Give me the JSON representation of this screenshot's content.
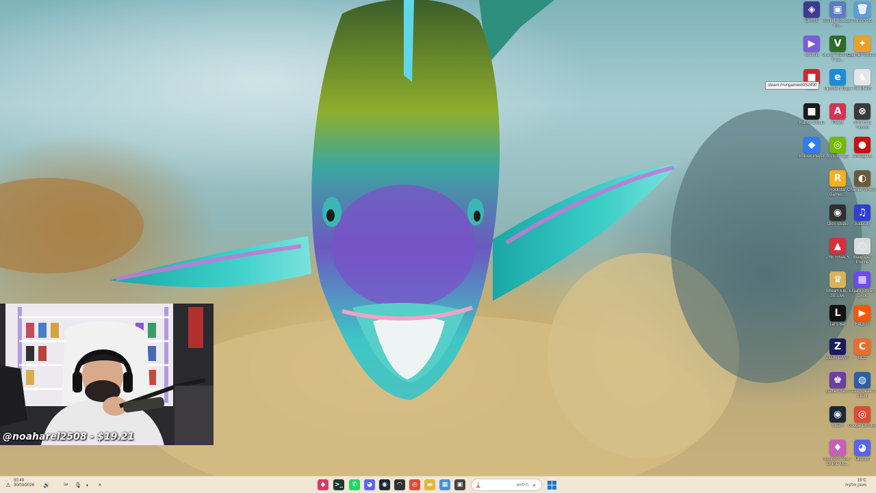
{
  "desktop_icons": [
    {
      "id": "exodus",
      "label": "Exodus",
      "glyph": "◈",
      "color": "#3d3a8f",
      "icon": "exodus-icon"
    },
    {
      "id": "rockstar-launcher",
      "label": "Rocket Software Inc...",
      "glyph": "▣",
      "color": "#5b7cc4",
      "icon": "app-shortcut-icon"
    },
    {
      "id": "recycle-bin",
      "label": "סל המחזור",
      "glyph": "🗑",
      "color": "#5d9fd8",
      "icon": "recycle-bin-icon"
    },
    {
      "id": "streamio",
      "label": "Stremio",
      "glyph": "▶",
      "color": "#7b5cd6",
      "icon": "stremio-icon"
    },
    {
      "id": "gta-v",
      "label": "Grand Theft Auto V Le...",
      "glyph": "V",
      "color": "#2f6b2a",
      "icon": "gta-icon"
    },
    {
      "id": "counter-strike",
      "label": "Counter-Strike 2",
      "glyph": "✦",
      "color": "#e9a227",
      "icon": "counter-strike-icon"
    },
    {
      "id": "roblox-red",
      "label": "Roblox",
      "glyph": "■",
      "color": "#c8292c",
      "icon": "roblox-red-icon"
    },
    {
      "id": "edge",
      "label": "Microsoft Edge",
      "glyph": "e",
      "color": "#1e8bd6",
      "icon": "edge-icon"
    },
    {
      "id": "fivem-chess",
      "label": "Fix Chess",
      "glyph": "♞",
      "color": "#e6e6e6",
      "icon": "chess-icon"
    },
    {
      "id": "roblox-studio",
      "label": "Roblox Studio",
      "glyph": "■",
      "color": "#1c1c1c",
      "icon": "roblox-studio-icon"
    },
    {
      "id": "fivem",
      "label": "FiveM",
      "glyph": "A",
      "color": "#d63455",
      "icon": "fivem-icon"
    },
    {
      "id": "steam-controller",
      "label": "מרכז ניהול המכשיר",
      "glyph": "⊗",
      "color": "#3a3a3a",
      "icon": "device-icon"
    },
    {
      "id": "roblox-player",
      "label": "Roblox Player",
      "glyph": "◆",
      "color": "#2e7ef0",
      "icon": "roblox-player-icon"
    },
    {
      "id": "nvidia",
      "label": "NVIDIA App",
      "glyph": "◎",
      "color": "#76b900",
      "icon": "nvidia-icon"
    },
    {
      "id": "among-us",
      "label": "Among Us",
      "glyph": "●",
      "color": "#c51111",
      "icon": "among-us-icon"
    },
    {
      "id": "rockstar",
      "label": "Rockstar Games...",
      "glyph": "R",
      "color": "#fcaf17",
      "icon": "rockstar-icon"
    },
    {
      "id": "chained",
      "label": "Chained Wheels",
      "glyph": "◐",
      "color": "#6b5a3a",
      "icon": "game-icon"
    },
    {
      "id": "obs",
      "label": "OBS Studio",
      "glyph": "◉",
      "color": "#302e31",
      "icon": "obs-icon"
    },
    {
      "id": "audacity",
      "label": "Audacity",
      "glyph": "♫",
      "color": "#2f3fd1",
      "icon": "audacity-icon"
    },
    {
      "id": "the-finals",
      "label": "THE FINALS",
      "glyph": "▲",
      "color": "#d6303c",
      "icon": "the-finals-icon"
    },
    {
      "id": "wallpaper",
      "label": "Wallpaper Engine",
      "glyph": "◌",
      "color": "#dcdcdc",
      "icon": "wallpaper-engine-icon"
    },
    {
      "id": "streamelements",
      "label": "Stream Ele... SE.Live",
      "glyph": "♛",
      "color": "#d9b35a",
      "icon": "streamelements-icon"
    },
    {
      "id": "elgato",
      "label": "Elgato Stream Deck",
      "glyph": "▦",
      "color": "#6c4cf0",
      "icon": "stream-deck-icon"
    },
    {
      "id": "lets-bet",
      "label": "Let's Bet",
      "glyph": "L",
      "color": "#111111",
      "icon": "lets-bet-icon"
    },
    {
      "id": "faceit",
      "label": "FACEIT",
      "glyph": "▶",
      "color": "#ff5500",
      "icon": "faceit-icon"
    },
    {
      "id": "zeus-cast",
      "label": "ZEUS CAST",
      "glyph": "Z",
      "color": "#1a1a5e",
      "icon": "zeus-cast-icon"
    },
    {
      "id": "gcc",
      "label": "GCC",
      "glyph": "C",
      "color": "#ec6b2d",
      "icon": "gcc-icon"
    },
    {
      "id": "battle-net",
      "label": "Battle.Chess",
      "glyph": "♚",
      "color": "#6a3fa0",
      "icon": "game-icon"
    },
    {
      "id": "teamspeak",
      "label": "TeamSpeak 3 Client",
      "glyph": "◍",
      "color": "#2a5ea8",
      "icon": "teamspeak-icon"
    },
    {
      "id": "steam",
      "label": "Steam",
      "glyph": "◉",
      "color": "#1b2838",
      "icon": "steam-icon"
    },
    {
      "id": "chrome",
      "label": "Google Chrome",
      "glyph": "◎",
      "color": "#dd4b39",
      "icon": "chrome-icon"
    },
    {
      "id": "business-tour",
      "label": "Business Tour - Online Mu...",
      "glyph": "♦",
      "color": "#c65fb7",
      "icon": "business-tour-icon"
    },
    {
      "id": "discord",
      "label": "Discord",
      "glyph": "◕",
      "color": "#5865f2",
      "icon": "discord-icon"
    }
  ],
  "tooltip": "steam://rungameid/252490",
  "webcam": {
    "caption": "@noaharel2508 - $19.21"
  },
  "taskbar": {
    "clock_time": "00:49",
    "clock_date": "30/03/2026",
    "language": "ENG",
    "language_sub": "עב",
    "weather_temp": "15°C",
    "weather_desc": "מעונן חלקית",
    "search_placeholder": "חיפוש",
    "pinned": [
      {
        "id": "copilot",
        "glyph": "◆",
        "color": "#d23d6d",
        "icon": "copilot-icon"
      },
      {
        "id": "terminal",
        "glyph": ">_",
        "color": "#1f3a2e",
        "icon": "terminal-icon"
      },
      {
        "id": "whatsapp",
        "glyph": "✆",
        "color": "#25d366",
        "icon": "whatsapp-icon"
      },
      {
        "id": "discord",
        "glyph": "◕",
        "color": "#5865f2",
        "icon": "discord-icon"
      },
      {
        "id": "steam",
        "glyph": "◉",
        "color": "#1b2838",
        "icon": "steam-icon"
      },
      {
        "id": "headset",
        "glyph": "◠",
        "color": "#333333",
        "icon": "headset-icon"
      },
      {
        "id": "chrome",
        "glyph": "◎",
        "color": "#dd4b39",
        "icon": "chrome-icon"
      },
      {
        "id": "explorer",
        "glyph": "▬",
        "color": "#e7b73a",
        "icon": "folder-icon"
      },
      {
        "id": "store",
        "glyph": "▦",
        "color": "#4a90d9",
        "icon": "store-icon"
      },
      {
        "id": "task-view",
        "glyph": "▣",
        "color": "#444444",
        "icon": "task-view-icon"
      }
    ]
  }
}
